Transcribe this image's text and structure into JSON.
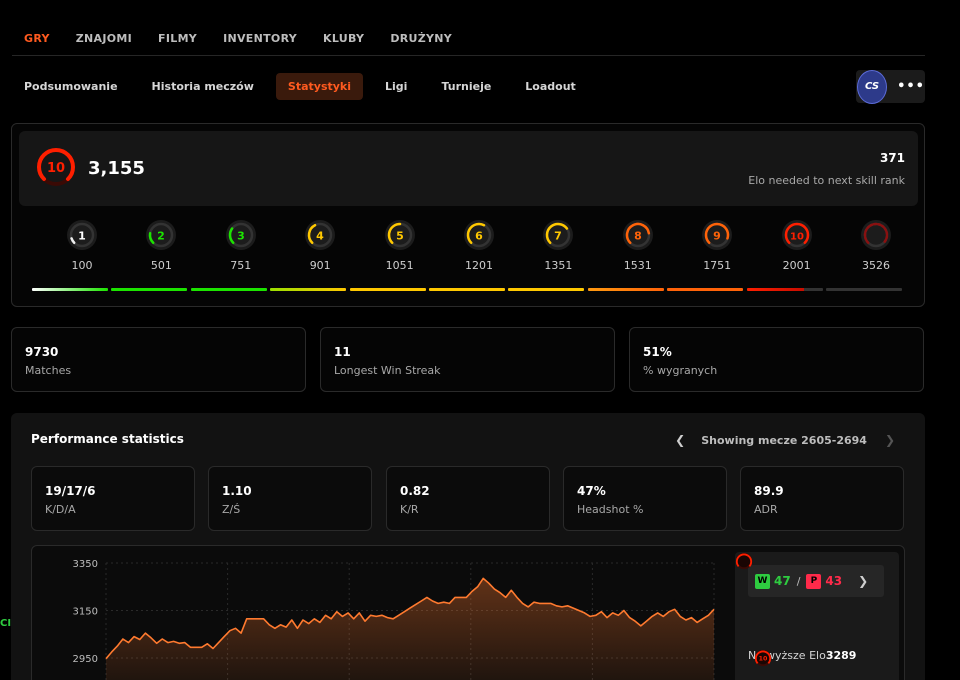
{
  "topnav": {
    "tabs": [
      {
        "label": "GRY",
        "active": true
      },
      {
        "label": "ZNAJOMI"
      },
      {
        "label": "FILMY"
      },
      {
        "label": "INVENTORY"
      },
      {
        "label": "KLUBY"
      },
      {
        "label": "DRUŻYNY"
      }
    ]
  },
  "subnav": {
    "tabs": [
      {
        "label": "Podsumowanie"
      },
      {
        "label": "Historia meczów"
      },
      {
        "label": "Statystyki",
        "active": true
      },
      {
        "label": "Ligi"
      },
      {
        "label": "Turnieje"
      },
      {
        "label": "Loadout"
      }
    ],
    "game_logo": "CS",
    "more": "•••"
  },
  "elo": {
    "level": "10",
    "value": "3,155",
    "next_needed": "371",
    "next_label": "Elo needed to next skill rank",
    "levels": [
      {
        "level": "1",
        "elo": "100",
        "color": "#eeeeee"
      },
      {
        "level": "2",
        "elo": "501",
        "color": "#1ce400"
      },
      {
        "level": "3",
        "elo": "751",
        "color": "#1ce400"
      },
      {
        "level": "4",
        "elo": "901",
        "color": "#ffc800"
      },
      {
        "level": "5",
        "elo": "1051",
        "color": "#ffc800"
      },
      {
        "level": "6",
        "elo": "1201",
        "color": "#ffc800"
      },
      {
        "level": "7",
        "elo": "1351",
        "color": "#ffc800"
      },
      {
        "level": "8",
        "elo": "1531",
        "color": "#ff6309"
      },
      {
        "level": "9",
        "elo": "1751",
        "color": "#ff6309"
      },
      {
        "level": "10",
        "elo": "2001",
        "color": "#fe1f00"
      },
      {
        "level": "",
        "elo": "3526",
        "color": "#8a1010"
      }
    ],
    "progress_colors": [
      "#eeeeee",
      "#1ce400",
      "#1ce400",
      "#ffc800",
      "#ffc800",
      "#ffc800",
      "#ffc800",
      "#ff6309",
      "#ff6309",
      "#fe1f00",
      "#333333"
    ],
    "last_segment_fill": 0.75
  },
  "stats": [
    {
      "value": "9730",
      "label": "Matches"
    },
    {
      "value": "11",
      "label": "Longest Win Streak"
    },
    {
      "value": "51%",
      "label": "% wygranych"
    }
  ],
  "performance": {
    "title": "Performance statistics",
    "pager_text": "Showing mecze 2605-2694",
    "stats": [
      {
        "value": "19/17/6",
        "label": "K/D/A"
      },
      {
        "value": "1.10",
        "label": "Z/Ś"
      },
      {
        "value": "0.82",
        "label": "K/R"
      },
      {
        "value": "47%",
        "label": "Headshot %"
      },
      {
        "value": "89.9",
        "label": "ADR"
      }
    ],
    "wins_badge": "W",
    "wins": "47",
    "losses_badge": "P",
    "losses": "43",
    "highest_label": "Najwyższe Elo",
    "highest_value": "3289",
    "highest_level": "10"
  },
  "left_stub": "CI",
  "chart_data": {
    "type": "line",
    "yticks": [
      "3350",
      "3150",
      "2950"
    ],
    "ylim": [
      2950,
      3350
    ],
    "color": "#ff7a2f",
    "values": [
      2947,
      2975,
      3000,
      3030,
      3015,
      3040,
      3028,
      3055,
      3035,
      3012,
      3030,
      3015,
      3020,
      3012,
      3015,
      2995,
      2995,
      2995,
      3010,
      2990,
      3015,
      3040,
      3065,
      3075,
      3055,
      3115,
      3115,
      3115,
      3115,
      3090,
      3075,
      3090,
      3080,
      3110,
      3075,
      3110,
      3095,
      3115,
      3100,
      3130,
      3115,
      3145,
      3125,
      3140,
      3115,
      3140,
      3105,
      3130,
      3125,
      3130,
      3120,
      3115,
      3130,
      3145,
      3160,
      3175,
      3190,
      3205,
      3190,
      3180,
      3185,
      3180,
      3205,
      3205,
      3205,
      3230,
      3250,
      3285,
      3265,
      3240,
      3225,
      3205,
      3235,
      3205,
      3180,
      3165,
      3185,
      3180,
      3180,
      3180,
      3170,
      3165,
      3170,
      3160,
      3150,
      3140,
      3125,
      3130,
      3145,
      3120,
      3140,
      3130,
      3150,
      3120,
      3105,
      3085,
      3105,
      3125,
      3140,
      3125,
      3145,
      3155,
      3125,
      3110,
      3120,
      3100,
      3115,
      3130,
      3155
    ]
  }
}
